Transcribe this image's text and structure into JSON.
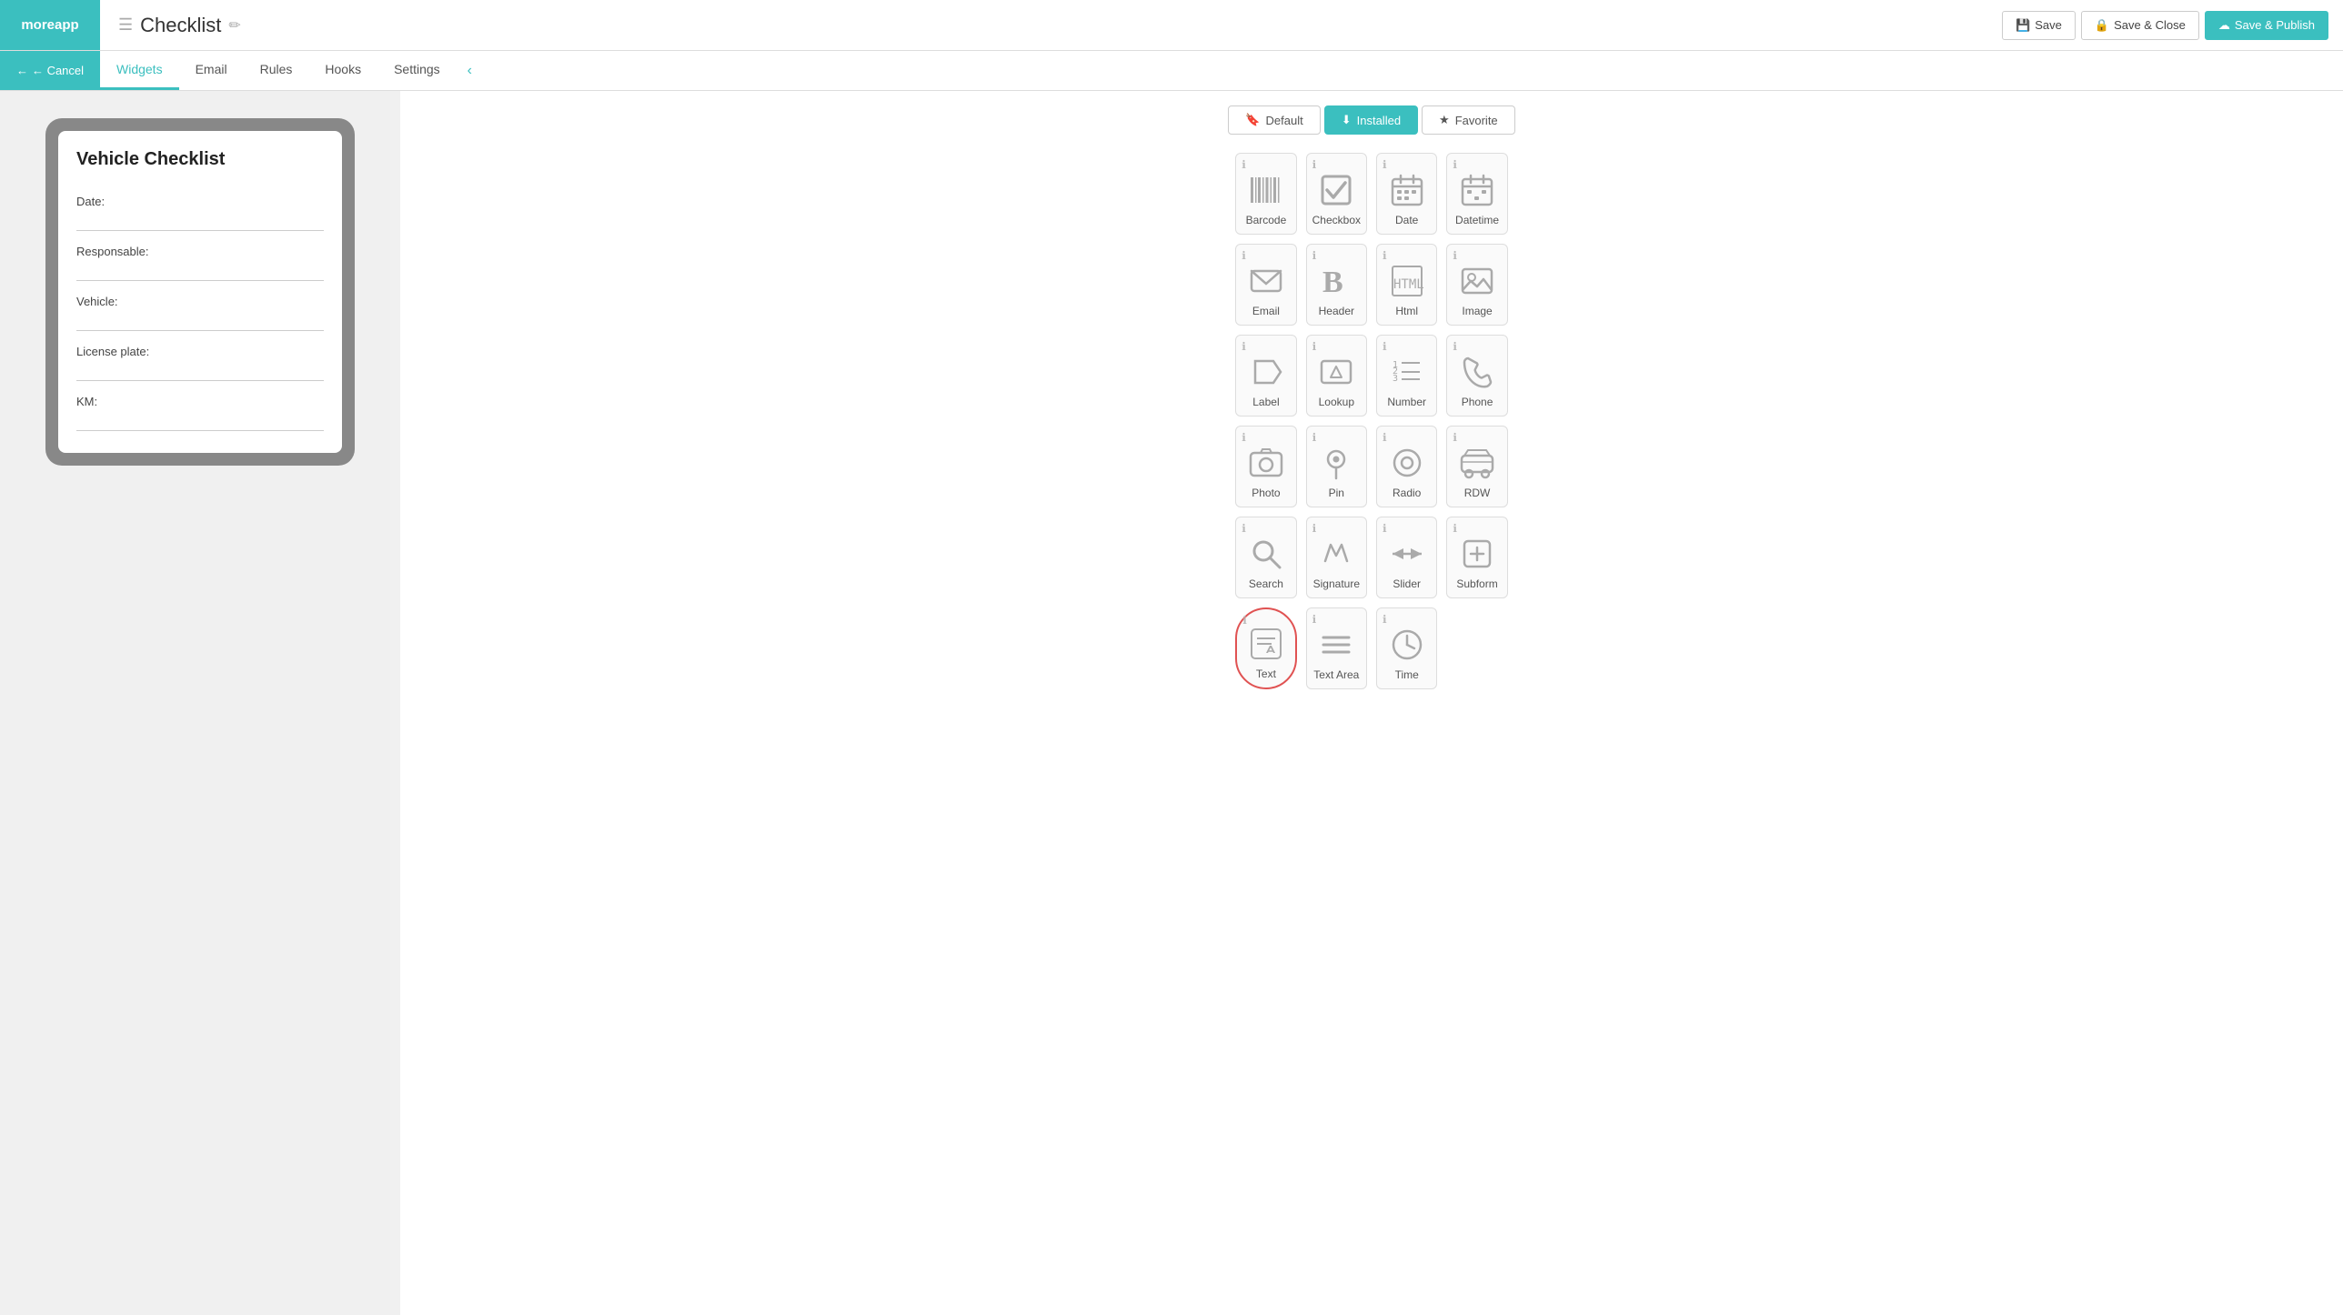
{
  "logo": {
    "text": "moreapp"
  },
  "header": {
    "title_icon": "☰",
    "title": "Checklist",
    "edit_icon": "✏",
    "save_label": "Save",
    "save_close_label": "Save & Close",
    "save_publish_label": "Save & Publish"
  },
  "nav": {
    "cancel_label": "← Cancel",
    "tabs": [
      {
        "label": "Widgets",
        "active": true
      },
      {
        "label": "Email",
        "active": false
      },
      {
        "label": "Rules",
        "active": false
      },
      {
        "label": "Hooks",
        "active": false
      },
      {
        "label": "Settings",
        "active": false
      }
    ]
  },
  "preview": {
    "form_title": "Vehicle Checklist",
    "fields": [
      {
        "label": "Date:"
      },
      {
        "label": "Responsable:"
      },
      {
        "label": "Vehicle:"
      },
      {
        "label": "License plate:"
      },
      {
        "label": "KM:"
      }
    ]
  },
  "widget_panel": {
    "tabs": [
      {
        "label": "Default",
        "icon": "🔖",
        "active": false
      },
      {
        "label": "Installed",
        "icon": "⬇",
        "active": true
      },
      {
        "label": "Favorite",
        "icon": "★",
        "active": false
      }
    ],
    "widgets": [
      {
        "id": "barcode",
        "label": "Barcode",
        "icon": "barcode",
        "highlighted": false
      },
      {
        "id": "checkbox",
        "label": "Checkbox",
        "icon": "checkbox",
        "highlighted": false
      },
      {
        "id": "date",
        "label": "Date",
        "icon": "date",
        "highlighted": false
      },
      {
        "id": "datetime",
        "label": "Datetime",
        "icon": "datetime",
        "highlighted": false
      },
      {
        "id": "email",
        "label": "Email",
        "icon": "email",
        "highlighted": false
      },
      {
        "id": "header",
        "label": "Header",
        "icon": "header",
        "highlighted": false
      },
      {
        "id": "html",
        "label": "Html",
        "icon": "html",
        "highlighted": false
      },
      {
        "id": "image",
        "label": "Image",
        "icon": "image",
        "highlighted": false
      },
      {
        "id": "label",
        "label": "Label",
        "icon": "label",
        "highlighted": false
      },
      {
        "id": "lookup",
        "label": "Lookup",
        "icon": "lookup",
        "highlighted": false
      },
      {
        "id": "number",
        "label": "Number",
        "icon": "number",
        "highlighted": false
      },
      {
        "id": "phone",
        "label": "Phone",
        "icon": "phone",
        "highlighted": false
      },
      {
        "id": "photo",
        "label": "Photo",
        "icon": "photo",
        "highlighted": false
      },
      {
        "id": "pin",
        "label": "Pin",
        "icon": "pin",
        "highlighted": false
      },
      {
        "id": "radio",
        "label": "Radio",
        "icon": "radio",
        "highlighted": false
      },
      {
        "id": "rdw",
        "label": "RDW",
        "icon": "rdw",
        "highlighted": false
      },
      {
        "id": "search",
        "label": "Search",
        "icon": "search",
        "highlighted": false
      },
      {
        "id": "signature",
        "label": "Signature",
        "icon": "signature",
        "highlighted": false
      },
      {
        "id": "slider",
        "label": "Slider",
        "icon": "slider",
        "highlighted": false
      },
      {
        "id": "subform",
        "label": "Subform",
        "icon": "subform",
        "highlighted": false
      },
      {
        "id": "text",
        "label": "Text",
        "icon": "text",
        "highlighted": true
      },
      {
        "id": "textarea",
        "label": "Text Area",
        "icon": "textarea",
        "highlighted": false
      },
      {
        "id": "time",
        "label": "Time",
        "icon": "time",
        "highlighted": false
      }
    ]
  }
}
